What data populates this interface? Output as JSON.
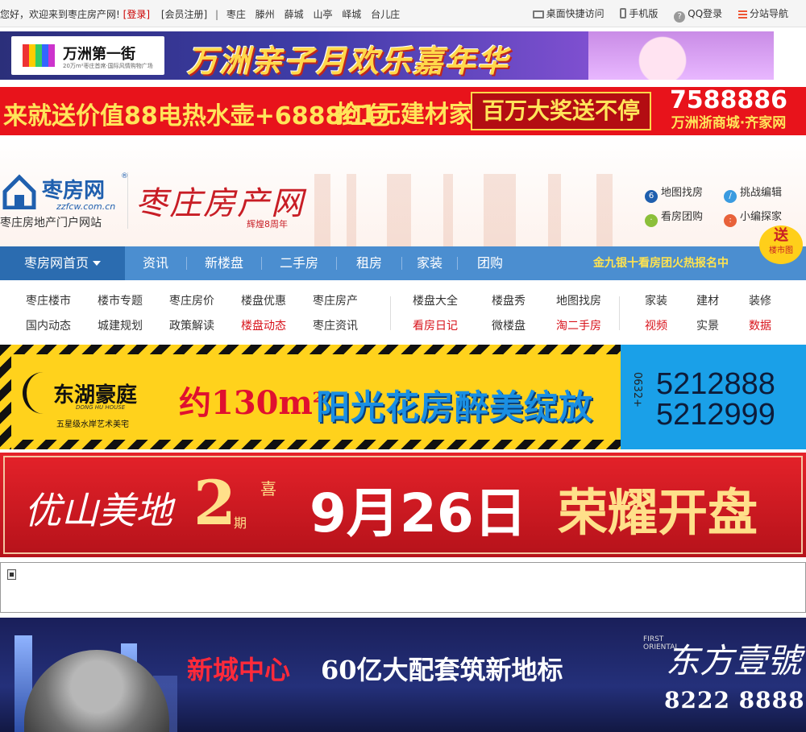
{
  "topbar": {
    "greeting": "您好，欢迎来到枣庄房产网!",
    "login": "[登录]",
    "register": "[会员注册]",
    "divider": "|",
    "cities": [
      "枣庄",
      "滕州",
      "薛城",
      "山亭",
      "峄城",
      "台儿庄"
    ],
    "desktop": "桌面快捷访问",
    "mobile": "手机版",
    "qq_login": "QQ登录",
    "branches": "分站导航"
  },
  "ads": {
    "ad1": {
      "logo_name": "万洲第一街",
      "logo_sub": "20万m²枣庄首席·国际风情购物广场",
      "slogan": "万洲亲子月欢乐嘉年华"
    },
    "ad2": {
      "part1": "来就送价值88电热水壶",
      "part2": "+6888红包",
      "part3": "抢1元建材家居",
      "part4": "百万大奖送不停",
      "phone": "7588886",
      "store": "万洲浙商城·齐家网"
    },
    "ad3": {
      "logo_name": "东湖豪庭",
      "logo_en": "DONG HU HOUSE",
      "logo_sub": "五星级水岸艺术美宅",
      "area": "约130m",
      "area_sup": "2",
      "slogan": "阳光花房醉美绽放",
      "prefix": "0632+",
      "phone1": "5212888",
      "phone2": "5212999"
    },
    "ad4": {
      "name": "优山美地",
      "phase": "2",
      "phase_unit": "期",
      "seal": "喜",
      "date": "9月26日",
      "headline": "荣耀开盘"
    },
    "ad5": {
      "location": "新城中心",
      "tagline": "60亿大配套筑新地标",
      "emblem": "FIRST ORIENTAL",
      "brand": "东方壹號",
      "phone": "8222 8888"
    }
  },
  "header": {
    "logo_name": "枣房网",
    "logo_reg": "®",
    "logo_domain": "zzfcw.com.cn",
    "logo_tag": "枣庄房地产门户网站",
    "brand": "枣庄房产网",
    "brand_badge": "辉煌8周年",
    "quick_links": [
      "地图找房",
      "挑战编辑",
      "看房团购",
      "小编探家"
    ]
  },
  "nav": {
    "home": "枣房网首页",
    "tabs": [
      "资讯",
      "新楼盘",
      "二手房",
      "租房",
      "家装",
      "团购"
    ],
    "promo": "金九银十看房团火热报名中",
    "send_big": "送",
    "send_small": "楼市图"
  },
  "subnav": {
    "group1_row1": [
      "枣庄楼市",
      "楼市专题",
      "枣庄房价",
      "楼盘优惠",
      "枣庄房产"
    ],
    "group1_row2": [
      "国内动态",
      "城建规划",
      "政策解读",
      "楼盘动态",
      "枣庄资讯"
    ],
    "group2_row1": [
      "楼盘大全",
      "楼盘秀",
      "地图找房"
    ],
    "group2_row2": [
      "看房日记",
      "微楼盘",
      "淘二手房"
    ],
    "group3_row1": [
      "家装",
      "建材",
      "装修"
    ],
    "group3_row2": [
      "视频",
      "实景",
      "数据"
    ]
  },
  "colors": {
    "nav_blue": "#4b8ed0",
    "nav_home": "#2b6cb0",
    "accent_red": "#d8131b",
    "promo_yellow": "#ffe34f"
  }
}
